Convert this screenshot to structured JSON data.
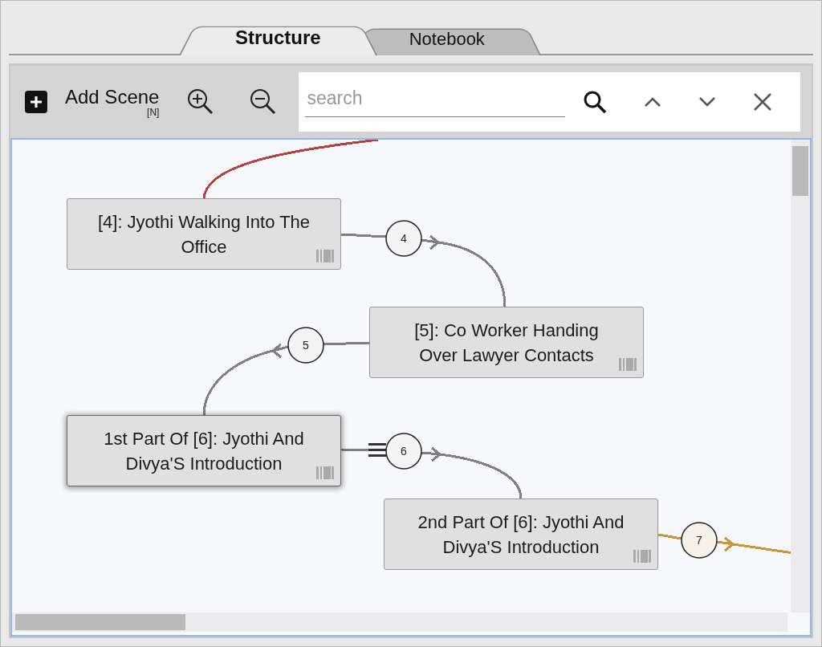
{
  "tabs": [
    {
      "label": "Structure",
      "selected": true
    },
    {
      "label": "Notebook",
      "selected": false
    }
  ],
  "toolbar": {
    "add_button": {
      "label": "Add Scene",
      "shortcut": "[N]"
    },
    "search": {
      "placeholder": "search"
    }
  },
  "scenes": [
    {
      "title": "[4]: Jyothi Walking Into The Office",
      "selected": false
    },
    {
      "title": "[5]: Co Worker Handing Over Lawyer Contacts",
      "selected": false
    },
    {
      "title": "1st Part Of [6]: Jyothi And Divya'S Introduction",
      "selected": true
    },
    {
      "title": "2nd Part Of [6]: Jyothi And Divya'S Introduction",
      "selected": false
    }
  ],
  "edges": [
    {
      "color": "#b5413f",
      "split": false
    },
    {
      "label": "4",
      "color": "#808080",
      "split": false
    },
    {
      "label": "5",
      "color": "#808080",
      "split": false
    },
    {
      "label": "6",
      "color": "#808080",
      "split": true
    },
    {
      "label": "7",
      "color": "#c8963c",
      "split": false
    }
  ]
}
